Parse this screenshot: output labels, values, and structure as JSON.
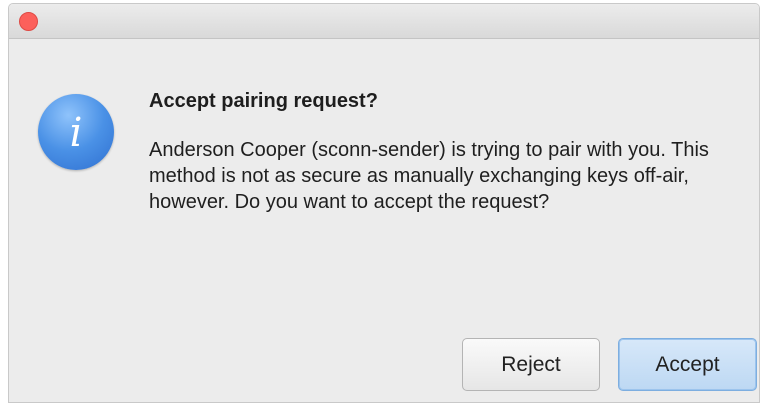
{
  "dialog": {
    "icon": "info-icon",
    "title": "Accept pairing request?",
    "message": "Anderson Cooper (sconn-sender) is trying to pair with you. This method is not as secure as manually exchanging keys off-air, however. Do you want to accept the request?",
    "buttons": {
      "reject_label": "Reject",
      "accept_label": "Accept"
    }
  },
  "colors": {
    "close_button": "#fc605b",
    "info_icon": "#4a91e6",
    "default_button": "#bdd8f3"
  }
}
